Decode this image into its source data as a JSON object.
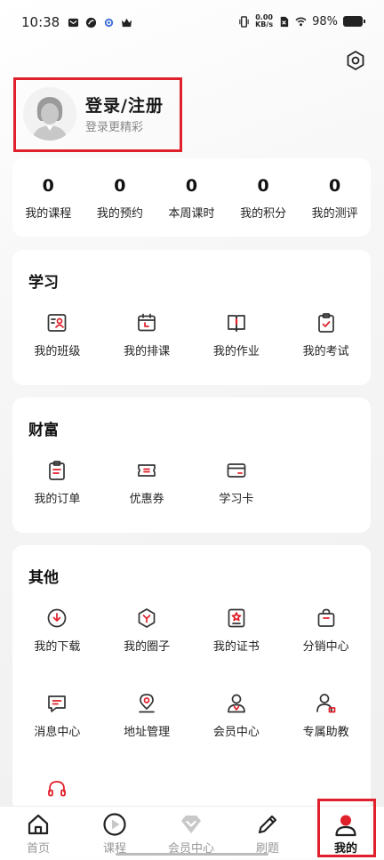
{
  "status_bar": {
    "time": "10:38",
    "net_speed_value": "0.00",
    "net_speed_unit": "KB/s",
    "battery": "98%"
  },
  "profile": {
    "title": "登录/注册",
    "subtitle": "登录更精彩"
  },
  "stats": [
    {
      "value": "0",
      "label": "我的课程"
    },
    {
      "value": "0",
      "label": "我的预约"
    },
    {
      "value": "0",
      "label": "本周课时"
    },
    {
      "value": "0",
      "label": "我的积分"
    },
    {
      "value": "0",
      "label": "我的测评"
    }
  ],
  "study": {
    "title": "学习",
    "items": [
      {
        "label": "我的班级",
        "icon": "class-icon"
      },
      {
        "label": "我的排课",
        "icon": "calendar-icon"
      },
      {
        "label": "我的作业",
        "icon": "homework-icon"
      },
      {
        "label": "我的考试",
        "icon": "exam-icon"
      }
    ]
  },
  "wealth": {
    "title": "财富",
    "items": [
      {
        "label": "我的订单",
        "icon": "order-icon"
      },
      {
        "label": "优惠券",
        "icon": "coupon-icon"
      },
      {
        "label": "学习卡",
        "icon": "card-icon"
      }
    ]
  },
  "other": {
    "title": "其他",
    "items": [
      {
        "label": "我的下载",
        "icon": "download-icon"
      },
      {
        "label": "我的圈子",
        "icon": "circle-icon"
      },
      {
        "label": "我的证书",
        "icon": "certificate-icon"
      },
      {
        "label": "分销中心",
        "icon": "shopping-bag-icon"
      },
      {
        "label": "消息中心",
        "icon": "message-icon"
      },
      {
        "label": "地址管理",
        "icon": "location-icon"
      },
      {
        "label": "会员中心",
        "icon": "member-icon"
      },
      {
        "label": "专属助教",
        "icon": "assistant-icon"
      },
      {
        "label": "",
        "icon": "headset-icon"
      }
    ]
  },
  "tabs": [
    {
      "label": "首页",
      "icon": "home-icon"
    },
    {
      "label": "课程",
      "icon": "play-icon"
    },
    {
      "label": "会员中心",
      "icon": "diamond-icon"
    },
    {
      "label": "刷题",
      "icon": "pencil-icon"
    },
    {
      "label": "我的",
      "icon": "user-icon",
      "active": true
    }
  ],
  "colors": {
    "accent": "#e0202a",
    "icon_stroke": "#333333"
  }
}
